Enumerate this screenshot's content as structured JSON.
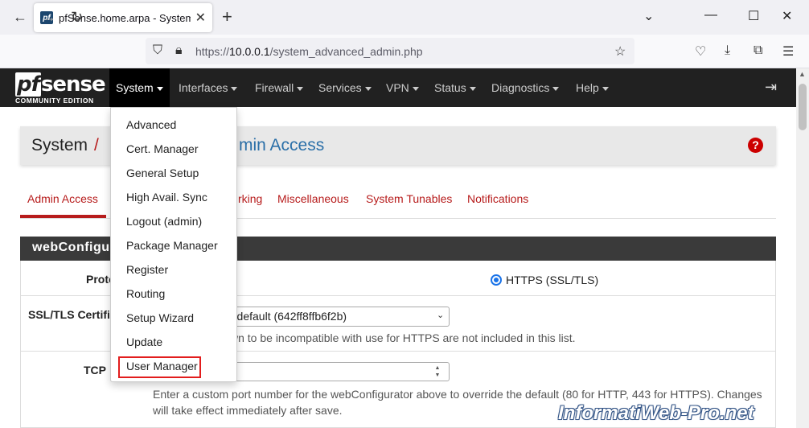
{
  "browser": {
    "tab_title": "pfSense.home.arpa - System: Advanced",
    "favicon_label": "pf",
    "url_scheme": "https://",
    "url_host": "10.0.0.1",
    "url_path": "/system_advanced_admin.php",
    "icons": [
      "back-icon",
      "forward-icon",
      "reload-icon",
      "shield-icon",
      "lock-icon",
      "bookmark-star-icon",
      "pocket-icon",
      "download-icon",
      "extensions-icon",
      "menu-icon"
    ]
  },
  "pfsense": {
    "logo_main": "sense",
    "logo_pf": "pf",
    "logo_sub": "COMMUNITY EDITION",
    "menu": [
      "System",
      "Interfaces",
      "Firewall",
      "Services",
      "VPN",
      "Status",
      "Diagnostics",
      "Help"
    ],
    "active_menu": "System"
  },
  "breadcrumb": {
    "section": "System",
    "separator": "/",
    "page_suffix": "min Access"
  },
  "subtabs": [
    "Admin Access",
    "rking",
    "Miscellaneous",
    "System Tunables",
    "Notifications"
  ],
  "panel": {
    "title": "webConfigu",
    "protocol_label": "Proto",
    "https_label": "HTTPS (SSL/TLS)",
    "ssl_label": "SSL/TLS Certific",
    "ssl_value": "r default (642ff8ffb6f2b)",
    "ssl_help": "wn to be incompatible with use for HTTPS are not included in this list.",
    "tcp_label": "TCP",
    "tcp_help_1": "Enter a custom port number for the webConfigurator above to override the default (80 for HTTP, 443 for HTTPS). Changes",
    "tcp_help_2": "will take effect immediately after save."
  },
  "dropdown": {
    "items": [
      "Advanced",
      "Cert. Manager",
      "General Setup",
      "High Avail. Sync",
      "Logout (admin)",
      "Package Manager",
      "Register",
      "Routing",
      "Setup Wizard",
      "Update",
      "User Manager"
    ],
    "highlighted": "User Manager"
  },
  "watermark": "InformatiWeb-Pro.net"
}
